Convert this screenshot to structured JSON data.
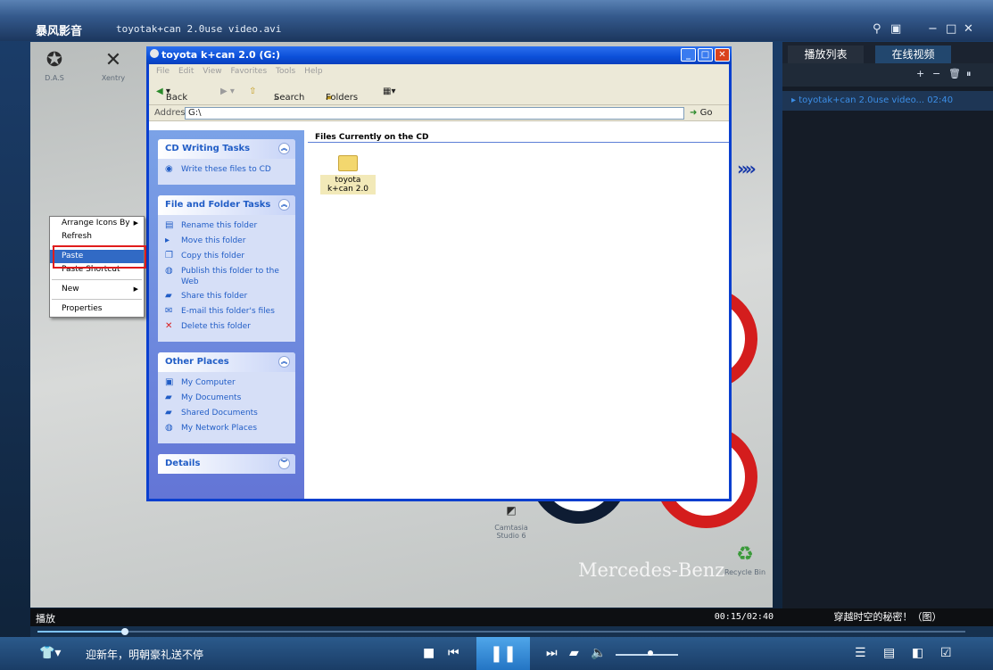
{
  "player": {
    "logo": "暴风影音",
    "file_title": "toyotak+can 2.0use video.avi",
    "status": "播放",
    "time": "00:15/02:40",
    "ad_left": "迎新年，明朝豪礼送不停",
    "ad_right": "穿越时空的秘密！（图）",
    "progress_fraction": 0.094,
    "volume_fraction": 0.55,
    "colors": {
      "accent": "#2475c4",
      "playlist_item": "#3c8ee6"
    }
  },
  "playlist": {
    "tabs": [
      "播放列表",
      "在线视频"
    ],
    "tools": [
      "+",
      "−",
      "🗑",
      "⏸"
    ],
    "items": [
      "toyotak+can 2.0use video... 02:40"
    ]
  },
  "desktop": {
    "icons": [
      {
        "label": "D.A.S",
        "glyph": "mercedes-star-icon"
      },
      {
        "label": "Xentry",
        "glyph": "xentry-icon"
      },
      {
        "label": "Camtasia Studio 6",
        "glyph": "camtasia-icon"
      },
      {
        "label": "Recycle Bin",
        "glyph": "recycle-bin-icon"
      }
    ],
    "brand": "Mercedes-Benz",
    "arrows": "»»"
  },
  "explorer": {
    "title": "toyota k+can 2.0 (G:)",
    "menu": [
      "File",
      "Edit",
      "View",
      "Favorites",
      "Tools",
      "Help"
    ],
    "toolbar": {
      "back": "Back",
      "search": "Search",
      "folders": "Folders"
    },
    "address_label": "Address",
    "address_value": "G:\\",
    "go": "Go",
    "content_header": "Files Currently on the CD",
    "folder_name": "toyota k+can 2.0",
    "panels": [
      {
        "title": "CD Writing Tasks",
        "items": [
          "Write these files to CD"
        ]
      },
      {
        "title": "File and Folder Tasks",
        "items": [
          "Rename this folder",
          "Move this folder",
          "Copy this folder",
          "Publish this folder to the Web",
          "Share this folder",
          "E-mail this folder's files",
          "Delete this folder"
        ]
      },
      {
        "title": "Other Places",
        "items": [
          "My Computer",
          "My Documents",
          "Shared Documents",
          "My Network Places"
        ]
      },
      {
        "title": "Details",
        "items": []
      }
    ]
  },
  "context_menu": {
    "items": [
      "Arrange Icons By",
      "Refresh",
      "Paste",
      "Paste Shortcut",
      "New",
      "Properties"
    ]
  }
}
